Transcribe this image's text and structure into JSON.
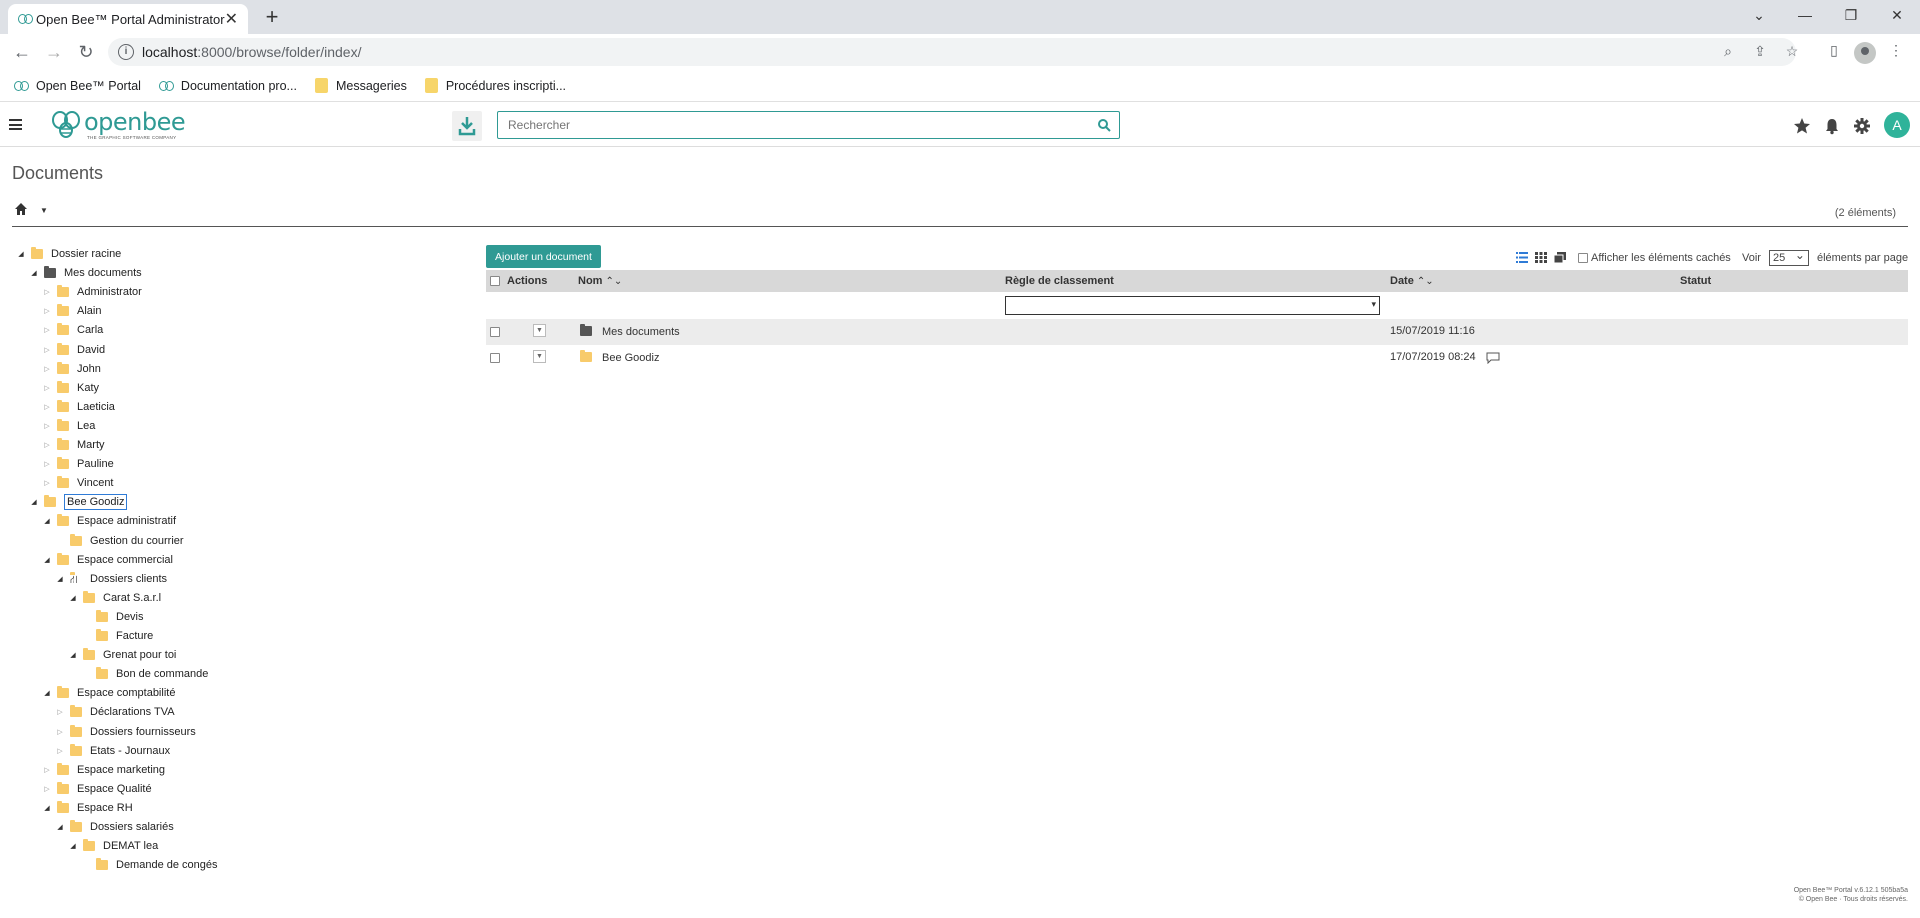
{
  "browser": {
    "tab_title": "Open Bee™ Portal Administrator",
    "url_host": "localhost",
    "url_rest": ":8000/browse/folder/index/",
    "bookmarks": [
      {
        "label": "Open Bee™ Portal",
        "icon": "bee-icon"
      },
      {
        "label": "Documentation pro...",
        "icon": "bee-icon"
      },
      {
        "label": "Messageries",
        "icon": "folder-icon"
      },
      {
        "label": "Procédures inscripti...",
        "icon": "folder-icon"
      }
    ]
  },
  "header": {
    "logo_text": "openbee",
    "logo_tagline": "THE GRAPHIC SOFTWARE COMPANY",
    "search_placeholder": "Rechercher",
    "avatar_letter": "A",
    "accent": "#2f9a94"
  },
  "page": {
    "title": "Documents",
    "count": "(2 éléments)"
  },
  "tree": [
    {
      "label": "Dossier racine",
      "depth": 0,
      "toggle": "open",
      "icon": "folder"
    },
    {
      "label": "Mes documents",
      "depth": 1,
      "toggle": "open",
      "icon": "dark"
    },
    {
      "label": "Administrator",
      "depth": 2,
      "toggle": "closed",
      "icon": "folder"
    },
    {
      "label": "Alain",
      "depth": 2,
      "toggle": "closed",
      "icon": "folder"
    },
    {
      "label": "Carla",
      "depth": 2,
      "toggle": "closed",
      "icon": "folder"
    },
    {
      "label": "David",
      "depth": 2,
      "toggle": "closed",
      "icon": "folder"
    },
    {
      "label": "John",
      "depth": 2,
      "toggle": "closed",
      "icon": "folder"
    },
    {
      "label": "Katy",
      "depth": 2,
      "toggle": "closed",
      "icon": "folder"
    },
    {
      "label": "Laeticia",
      "depth": 2,
      "toggle": "closed",
      "icon": "folder"
    },
    {
      "label": "Lea",
      "depth": 2,
      "toggle": "closed",
      "icon": "folder"
    },
    {
      "label": "Marty",
      "depth": 2,
      "toggle": "closed",
      "icon": "folder"
    },
    {
      "label": "Pauline",
      "depth": 2,
      "toggle": "closed",
      "icon": "folder"
    },
    {
      "label": "Vincent",
      "depth": 2,
      "toggle": "closed",
      "icon": "folder"
    },
    {
      "label": "Bee Goodiz",
      "depth": 1,
      "toggle": "open",
      "icon": "folder",
      "selected": true
    },
    {
      "label": "Espace administratif",
      "depth": 2,
      "toggle": "open",
      "icon": "folder"
    },
    {
      "label": "Gestion du courrier",
      "depth": 3,
      "toggle": "none",
      "icon": "folder"
    },
    {
      "label": "Espace commercial",
      "depth": 2,
      "toggle": "open",
      "icon": "folder"
    },
    {
      "label": "Dossiers clients",
      "depth": 3,
      "toggle": "open",
      "icon": "share"
    },
    {
      "label": "Carat S.a.r.l",
      "depth": 4,
      "toggle": "open",
      "icon": "folder"
    },
    {
      "label": "Devis",
      "depth": 5,
      "toggle": "none",
      "icon": "folder"
    },
    {
      "label": "Facture",
      "depth": 5,
      "toggle": "none",
      "icon": "folder"
    },
    {
      "label": "Grenat pour toi",
      "depth": 4,
      "toggle": "open",
      "icon": "folder"
    },
    {
      "label": "Bon de commande",
      "depth": 5,
      "toggle": "none",
      "icon": "folder"
    },
    {
      "label": "Espace comptabilité",
      "depth": 2,
      "toggle": "open",
      "icon": "folder"
    },
    {
      "label": "Déclarations TVA",
      "depth": 3,
      "toggle": "closed",
      "icon": "folder"
    },
    {
      "label": "Dossiers fournisseurs",
      "depth": 3,
      "toggle": "closed",
      "icon": "folder"
    },
    {
      "label": "Etats - Journaux",
      "depth": 3,
      "toggle": "closed",
      "icon": "folder"
    },
    {
      "label": "Espace marketing",
      "depth": 2,
      "toggle": "closed",
      "icon": "folder"
    },
    {
      "label": "Espace Qualité",
      "depth": 2,
      "toggle": "closed",
      "icon": "folder"
    },
    {
      "label": "Espace RH",
      "depth": 2,
      "toggle": "open",
      "icon": "folder"
    },
    {
      "label": "Dossiers salariés",
      "depth": 3,
      "toggle": "open",
      "icon": "folder"
    },
    {
      "label": "DEMAT lea",
      "depth": 4,
      "toggle": "open",
      "icon": "folder"
    },
    {
      "label": "Demande de congés",
      "depth": 5,
      "toggle": "none",
      "icon": "folder"
    }
  ],
  "grid": {
    "add_button": "Ajouter un document",
    "show_hidden": "Afficher les éléments cachés",
    "pager_prefix": "Voir",
    "pager_value": "25",
    "pager_suffix": "éléments par page",
    "columns": {
      "actions": "Actions",
      "name": "Nom",
      "rule": "Règle de classement",
      "date": "Date",
      "status": "Statut"
    },
    "rows": [
      {
        "name": "Mes documents",
        "date": "15/07/2019 11:16",
        "icon": "dark",
        "comment": false
      },
      {
        "name": "Bee Goodiz",
        "date": "17/07/2019 08:24",
        "icon": "folder",
        "comment": true
      }
    ]
  },
  "footer": {
    "line1": "Open Bee™ Portal v.6.12.1 505ba5a",
    "line2": "© Open Bee · Tous droits réservés."
  }
}
